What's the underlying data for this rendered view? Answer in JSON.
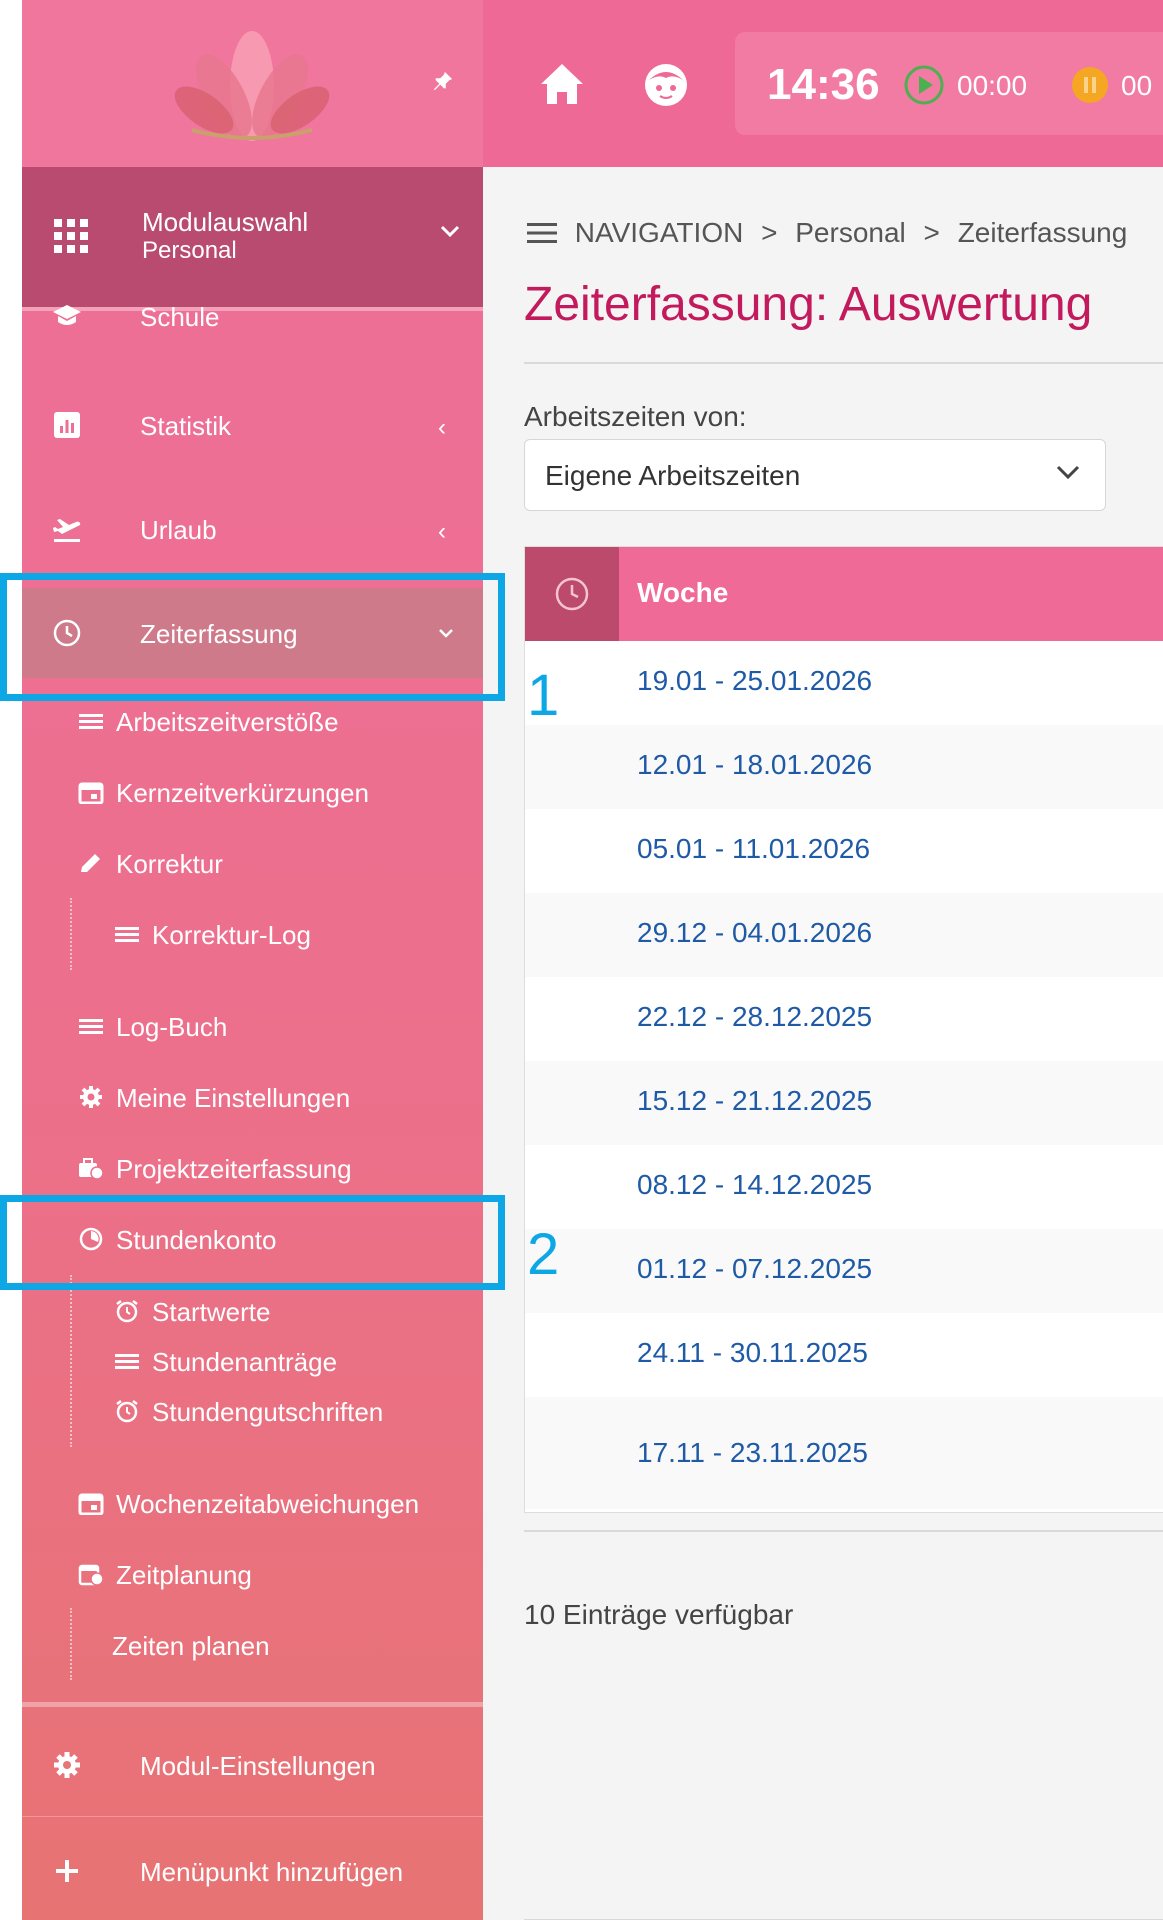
{
  "topbar": {
    "clock_time": "14:36",
    "play_time": "00:00",
    "pause_time": "00",
    "colors": {
      "bar": "#ef6996",
      "play": "#4caf50",
      "pause": "#f5a623"
    }
  },
  "sidebar": {
    "module_title": "Modulauswahl",
    "module_subtitle": "Personal",
    "items": {
      "schule": "Schule",
      "statistik": "Statistik",
      "urlaub": "Urlaub",
      "zeiterfassung": "Zeiterfassung",
      "arbeitszeitverstoesse": "Arbeitszeitverstöße",
      "kernzeitverkuerzungen": "Kernzeitverkürzungen",
      "korrektur": "Korrektur",
      "korrektur_log": "Korrektur-Log",
      "log_buch": "Log-Buch",
      "meine_einstellungen": "Meine Einstellungen",
      "projektzeiterfassung": "Projektzeiterfassung",
      "stundenkonto": "Stundenkonto",
      "startwerte": "Startwerte",
      "stundenantraege": "Stundenanträge",
      "stundengutschriften": "Stundengutschriften",
      "wochenzeitabweichungen": "Wochenzeitabweichungen",
      "zeitplanung": "Zeitplanung",
      "zeiten_planen": "Zeiten planen",
      "modul_einstellungen": "Modul-Einstellungen",
      "menuepunkt_hinzufuegen": "Menüpunkt hinzufügen"
    }
  },
  "breadcrumb": {
    "root": "NAVIGATION",
    "level1": "Personal",
    "level2": "Zeiterfassung",
    "separator": ">"
  },
  "main": {
    "title": "Zeiterfassung: Auswertung",
    "filter_label": "Arbeitszeiten von:",
    "filter_value": "Eigene Arbeitszeiten",
    "table_header": "Woche",
    "weeks": [
      "19.01 - 25.01.2026",
      "12.01 - 18.01.2026",
      "05.01 - 11.01.2026",
      "29.12 - 04.01.2026",
      "22.12 - 28.12.2025",
      "15.12 - 21.12.2025",
      "08.12 - 14.12.2025",
      "01.12 - 07.12.2025",
      "24.11 - 30.11.2025",
      "17.11 - 23.11.2025"
    ],
    "entries_count": "10 Einträge verfügbar"
  },
  "annotations": {
    "first": "1",
    "second": "2",
    "color": "#0ea7e6"
  }
}
